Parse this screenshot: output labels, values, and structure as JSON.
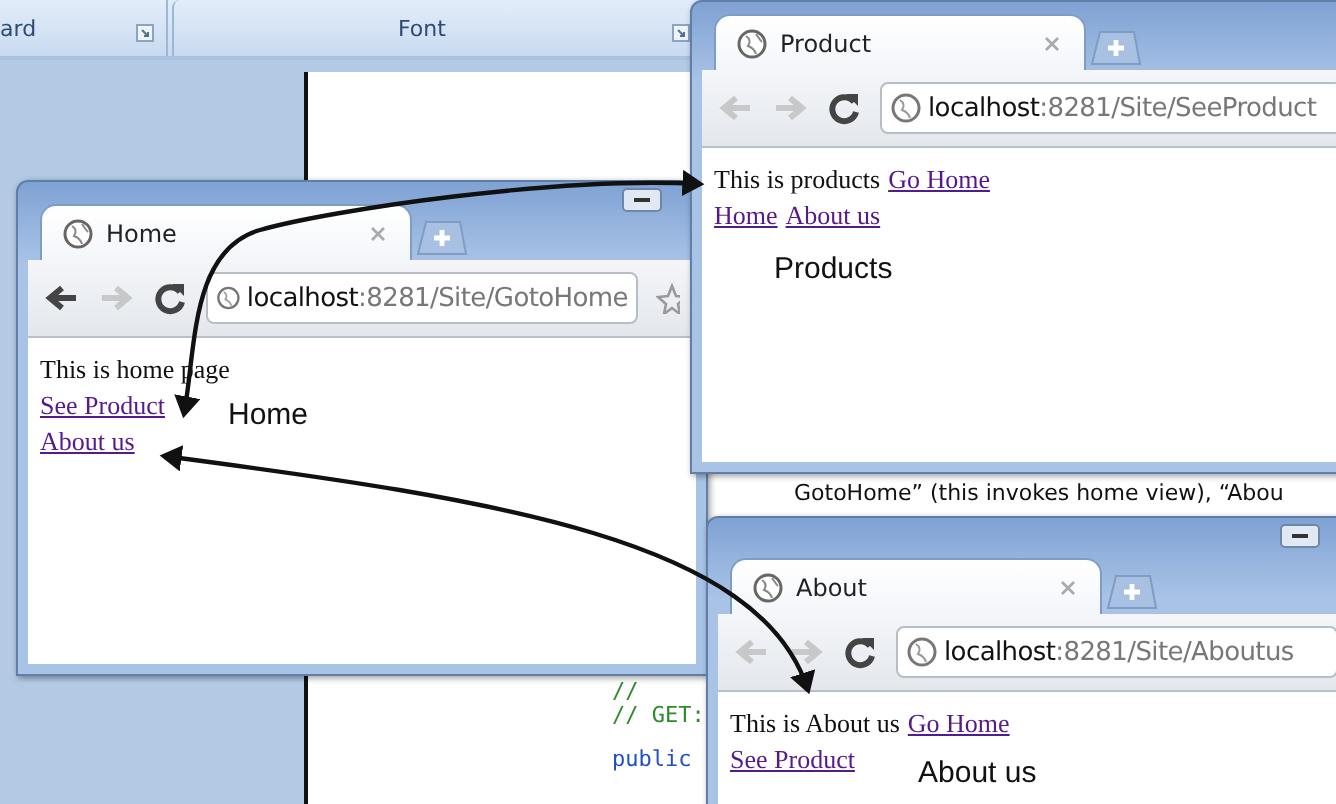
{
  "ribbon": {
    "groups": [
      {
        "label": "ard"
      },
      {
        "label": "Font"
      }
    ]
  },
  "document": {
    "text": "GotoHome” (this invokes home view), “Abou"
  },
  "code_lines": [
    "//",
    "// GET:",
    "public"
  ],
  "windows": [
    {
      "tab_title": "Home",
      "url_host": "localhost",
      "url_path": ":8281/Site/GotoHome",
      "back_enabled": true,
      "forward_enabled": false,
      "lines": [
        [
          {
            "text": "This is home page",
            "link": false
          }
        ],
        [
          {
            "text": "See Product",
            "link": true
          }
        ],
        [
          {
            "text": "About us",
            "link": true
          }
        ]
      ],
      "annotation": "Home"
    },
    {
      "tab_title": "Product",
      "url_host": "localhost",
      "url_path": ":8281/Site/SeeProduct",
      "back_enabled": false,
      "forward_enabled": false,
      "lines": [
        [
          {
            "text": "This is products",
            "link": false
          },
          {
            "text": "Go Home",
            "link": true
          }
        ],
        [
          {
            "text": "Home",
            "link": true
          },
          {
            "text": "About us",
            "link": true
          }
        ]
      ],
      "annotation": "Products"
    },
    {
      "tab_title": "About",
      "url_host": "localhost",
      "url_path": ":8281/Site/Aboutus",
      "back_enabled": false,
      "forward_enabled": false,
      "lines": [
        [
          {
            "text": "This is About us",
            "link": false
          },
          {
            "text": "Go Home",
            "link": true
          }
        ],
        [
          {
            "text": "See Product",
            "link": true
          }
        ]
      ],
      "annotation": "About us"
    }
  ]
}
